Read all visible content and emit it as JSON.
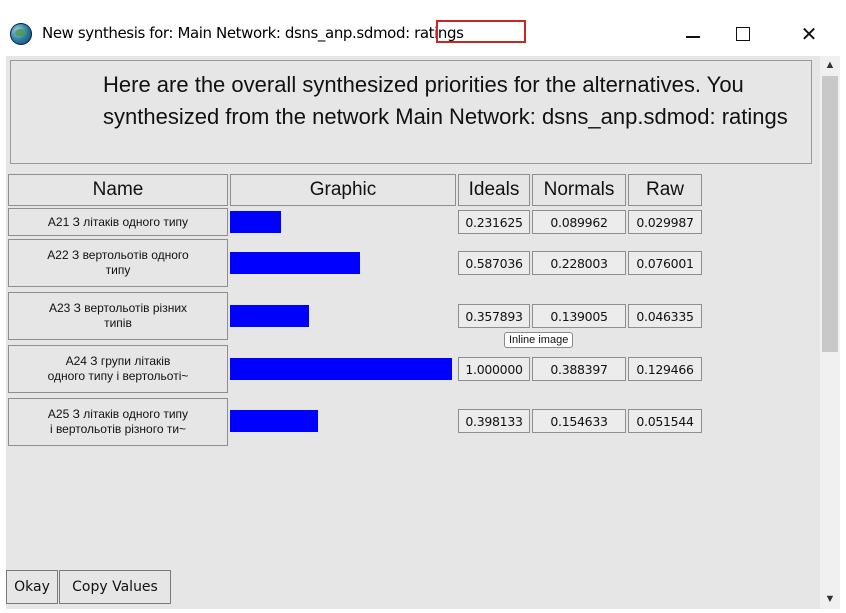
{
  "window": {
    "title": "New synthesis for: Main Network: dsns_anp.sdmod: ratings",
    "minimize_icon": "minimize-icon",
    "maximize_icon": "maximize-icon",
    "close_label": "✕"
  },
  "header": {
    "text": "Here are the overall synthesized priorities for the alternatives.  You synthesized from the network Main Network: dsns_anp.sdmod: ratings"
  },
  "table": {
    "columns": [
      "Name",
      "Graphic",
      "Ideals",
      "Normals",
      "Raw"
    ],
    "rows": [
      {
        "name": "A21 З літаків одного типу",
        "ideal": "0.231625",
        "normal": "0.089962",
        "raw": "0.029987",
        "bar_fraction": 0.231625
      },
      {
        "name": "A22 З вертольотів одного\nтипу",
        "ideal": "0.587036",
        "normal": "0.228003",
        "raw": "0.076001",
        "bar_fraction": 0.587036
      },
      {
        "name": "A23 З вертольотів різних\nтипів",
        "ideal": "0.357893",
        "normal": "0.139005",
        "raw": "0.046335",
        "bar_fraction": 0.357893
      },
      {
        "name": "A24 З групи літаків\nодного типу і вертольоті~",
        "ideal": "1.000000",
        "normal": "0.388397",
        "raw": "0.129466",
        "bar_fraction": 1.0
      },
      {
        "name": "A25 З літаків одного типу\nі вертольотів різного ти~",
        "ideal": "0.398133",
        "normal": "0.154633",
        "raw": "0.051544",
        "bar_fraction": 0.398133
      }
    ],
    "bar_color": "#0000ff"
  },
  "tooltip": "Inline image",
  "buttons": {
    "okay": "Okay",
    "copy_values": "Copy Values"
  }
}
